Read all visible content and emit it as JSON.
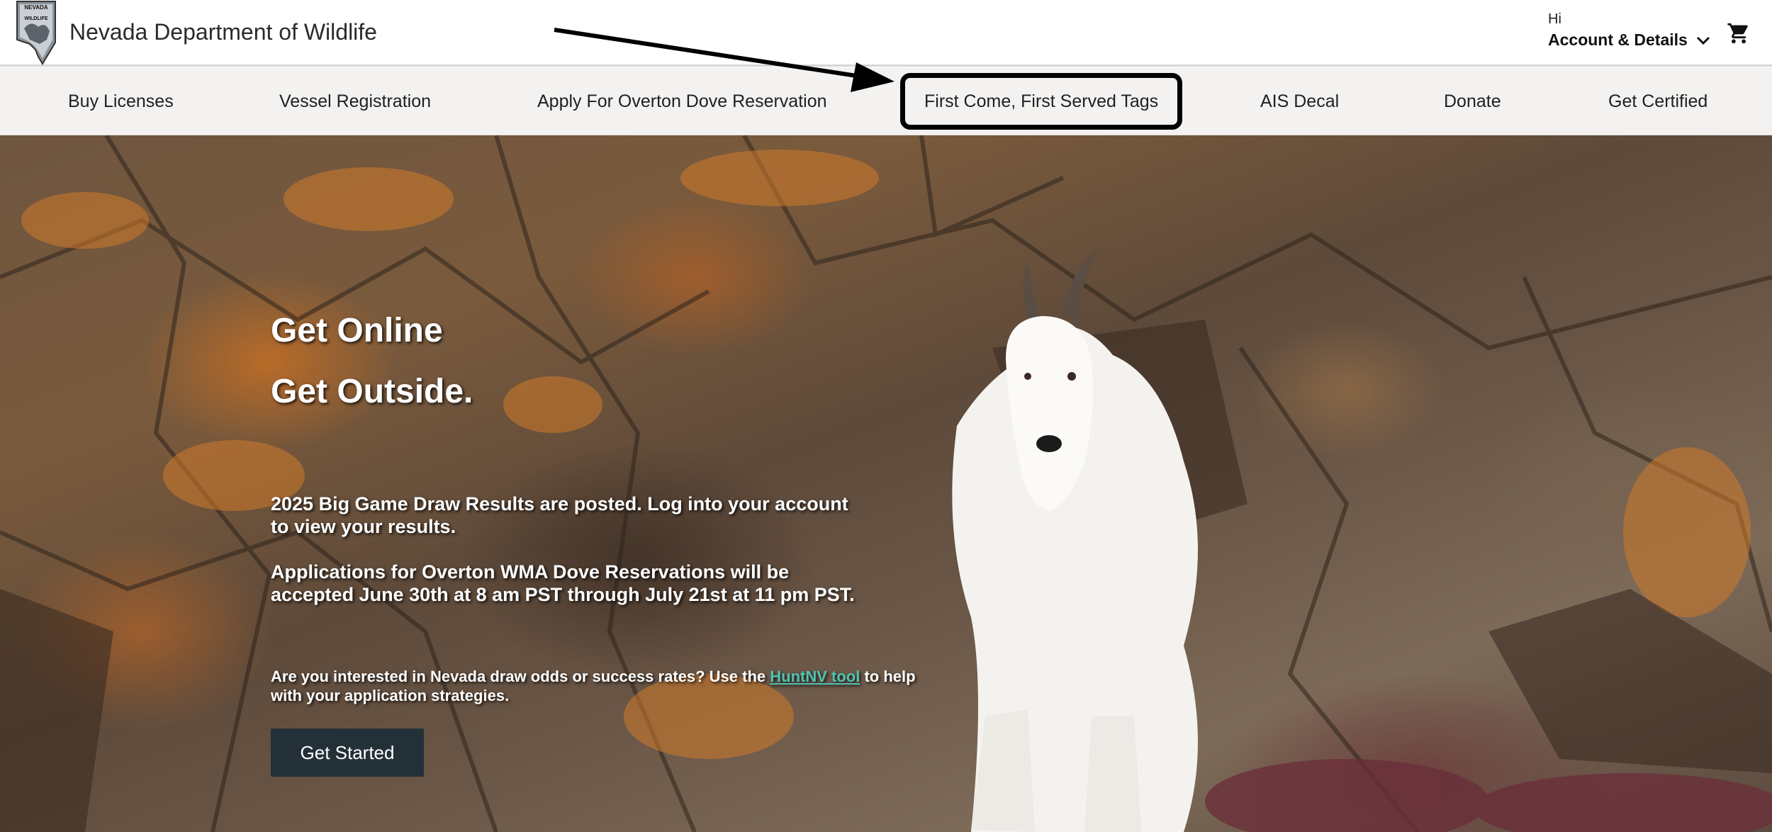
{
  "header": {
    "logo_text_top": "NEVADA",
    "logo_text_bottom": "WILDLIFE",
    "site_title": "Nevada Department of Wildlife",
    "account_greeting": "Hi",
    "account_label": "Account & Details",
    "cart_icon": "cart-icon"
  },
  "nav": {
    "items": [
      {
        "label": "Buy Licenses"
      },
      {
        "label": "Vessel Registration"
      },
      {
        "label": "Apply For Overton Dove Reservation"
      },
      {
        "label": "First Come, First Served Tags"
      },
      {
        "label": "AIS Decal"
      },
      {
        "label": "Donate"
      },
      {
        "label": "Get Certified"
      }
    ]
  },
  "hero": {
    "heading_line1": "Get Online",
    "heading_line2": "Get Outside.",
    "announcement1": "2025 Big Game Draw Results are posted. Log into your account to view your results.",
    "announcement2": "Applications for Overton WMA Dove Reservations will be accepted June 30th at 8 am PST through July 21st at 11 pm PST.",
    "odds_text_before": "Are you interested in Nevada draw odds or success rates? Use the ",
    "odds_link": "HuntNV tool",
    "odds_text_after": " to help with your application strategies.",
    "cta_label": "Get Started"
  },
  "colors": {
    "nav_bg": "#f3f2f0",
    "cta_bg": "#243038",
    "link": "#4fc3b2",
    "highlight_border": "#000000"
  }
}
